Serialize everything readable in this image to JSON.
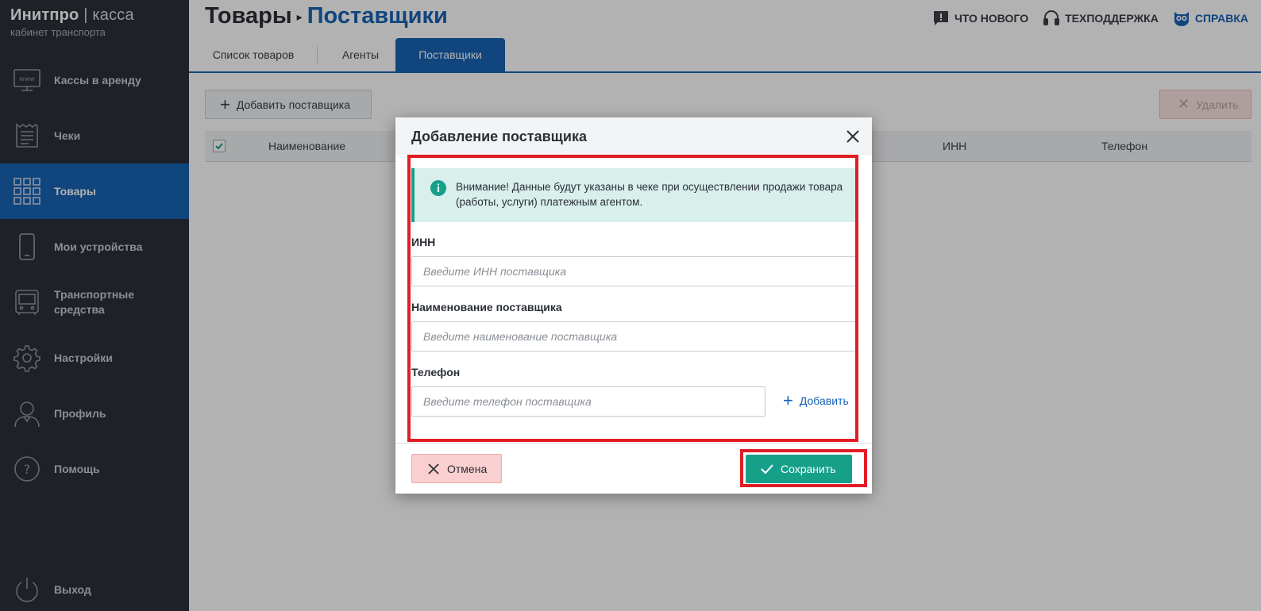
{
  "brand": {
    "name": "Инитпро",
    "separator": " | ",
    "product": "касса",
    "subtitle": "кабинет транспорта"
  },
  "sidebar": {
    "items": [
      {
        "label": "Кассы в аренду",
        "icon": "www-monitor-icon"
      },
      {
        "label": "Чеки",
        "icon": "receipt-icon"
      },
      {
        "label": "Товары",
        "icon": "grid-icon",
        "active": true
      },
      {
        "label": "Мои устройства",
        "icon": "phone-icon"
      },
      {
        "label": "Транспортные средства",
        "icon": "bus-icon"
      },
      {
        "label": "Настройки",
        "icon": "gear-icon"
      },
      {
        "label": "Профиль",
        "icon": "user-icon"
      },
      {
        "label": "Помощь",
        "icon": "help-icon"
      }
    ],
    "logout": "Выход"
  },
  "header": {
    "breadcrumb_parent": "Товары",
    "breadcrumb_current": "Поставщики",
    "links": {
      "whats_new": "ЧТО НОВОГО",
      "support": "ТЕХПОДДЕРЖКА",
      "help": "СПРАВКА"
    }
  },
  "tabs": [
    "Список товаров",
    "Агенты",
    "Поставщики"
  ],
  "toolbar": {
    "add_label": "Добавить поставщика",
    "delete_label": "Удалить"
  },
  "table": {
    "columns": [
      "Наименование",
      "ИНН",
      "Телефон"
    ]
  },
  "modal": {
    "title": "Добавление поставщика",
    "notice": "Внимание! Данные будут указаны в чеке при осуществлении продажи товара (работы, услуги) платежным агентом.",
    "fields": {
      "inn": {
        "label": "ИНН",
        "placeholder": "Введите ИНН поставщика"
      },
      "name": {
        "label": "Наименование поставщика",
        "placeholder": "Введите наименование поставщика"
      },
      "phone": {
        "label": "Телефон",
        "placeholder": "Введите телефон поставщика"
      }
    },
    "add_phone_label": "Добавить",
    "cancel_label": "Отмена",
    "save_label": "Сохранить"
  },
  "colors": {
    "accent": "#1763b5",
    "sidebar_bg": "#2c3038",
    "success": "#16a08a",
    "highlight": "#e01d26",
    "danger_bg": "#f9cfcf"
  }
}
